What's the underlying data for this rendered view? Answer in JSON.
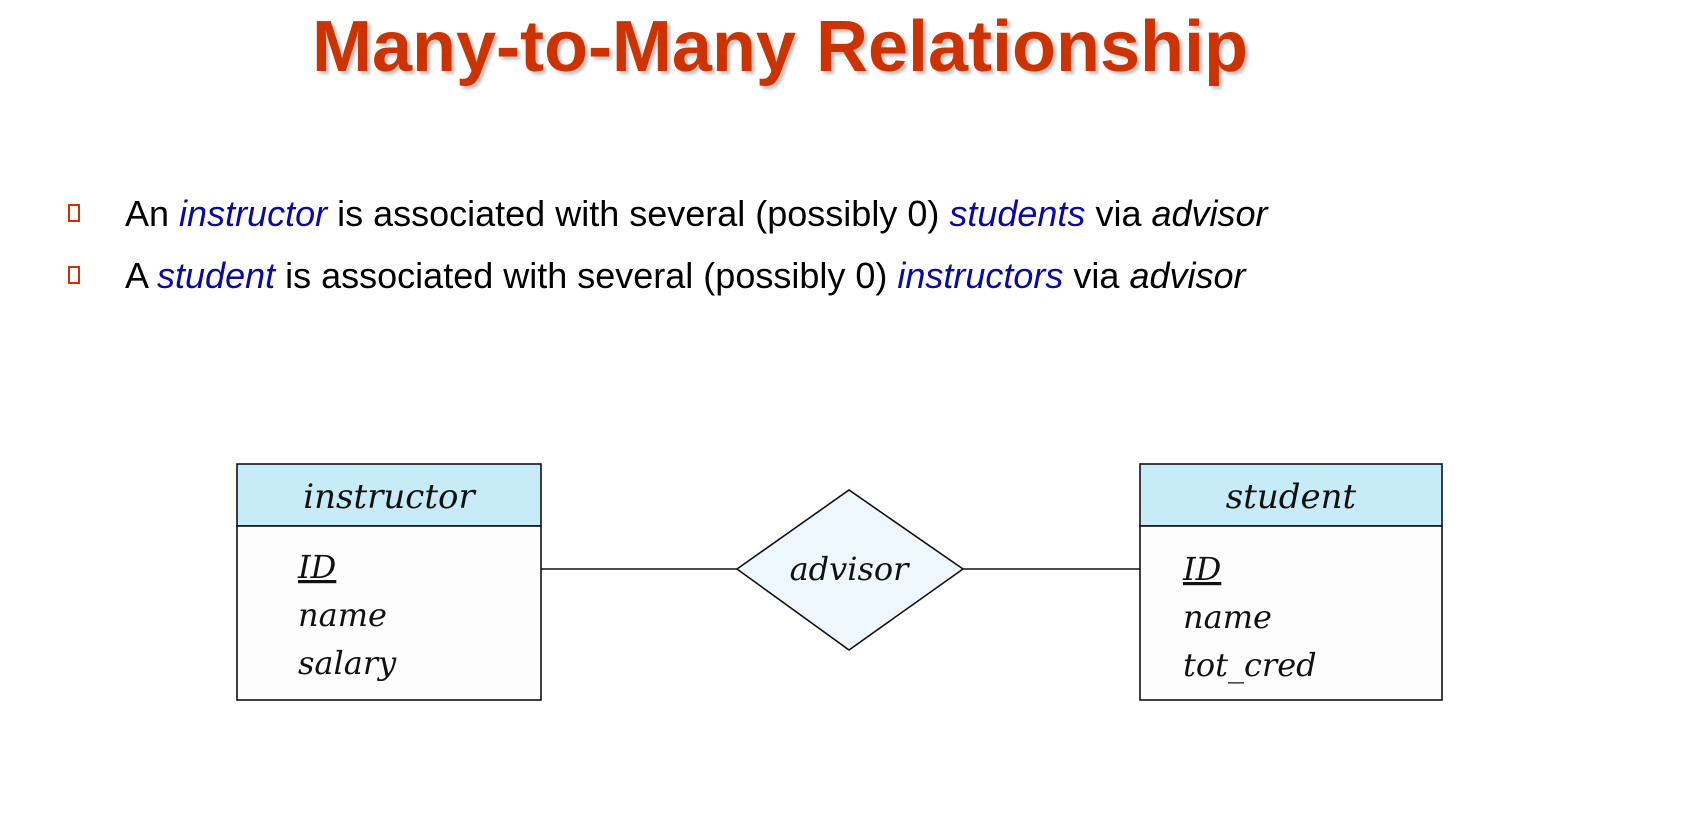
{
  "slide": {
    "title": "Many-to-Many Relationship",
    "bullets": [
      {
        "parts": [
          {
            "text": "An ",
            "style": "plain"
          },
          {
            "text": "instructor",
            "style": "em-blue"
          },
          {
            "text": " is associated with several (possibly 0) ",
            "style": "plain"
          },
          {
            "text": "students",
            "style": "em-blue"
          },
          {
            "text": " via ",
            "style": "plain"
          },
          {
            "text": "advisor",
            "style": "em-black"
          }
        ]
      },
      {
        "parts": [
          {
            "text": "A ",
            "style": "plain"
          },
          {
            "text": "student",
            "style": "em-blue"
          },
          {
            "text": " is associated with several (possibly 0) ",
            "style": "plain"
          },
          {
            "text": "instructors",
            "style": "em-blue"
          },
          {
            "text": " via ",
            "style": "plain"
          },
          {
            "text": "advisor",
            "style": "em-black"
          }
        ]
      }
    ]
  },
  "diagram": {
    "entities": [
      {
        "name": "instructor",
        "attributes": [
          {
            "text": "ID",
            "primary_key": true
          },
          {
            "text": "name",
            "primary_key": false
          },
          {
            "text": "salary",
            "primary_key": false
          }
        ]
      },
      {
        "name": "student",
        "attributes": [
          {
            "text": "ID",
            "primary_key": true
          },
          {
            "text": "name",
            "primary_key": false
          },
          {
            "text": "tot_cred",
            "primary_key": false
          }
        ]
      }
    ],
    "relationship": {
      "name": "advisor"
    }
  },
  "colors": {
    "title": "#cc3300",
    "bullet_marker": "#cc3300",
    "emphasis_blue": "#0a0a9e",
    "entity_header_fill": "#c8ecf7",
    "entity_body_fill": "#fdfdfd",
    "relationship_fill": "#eef7fd",
    "line": "#111111"
  }
}
